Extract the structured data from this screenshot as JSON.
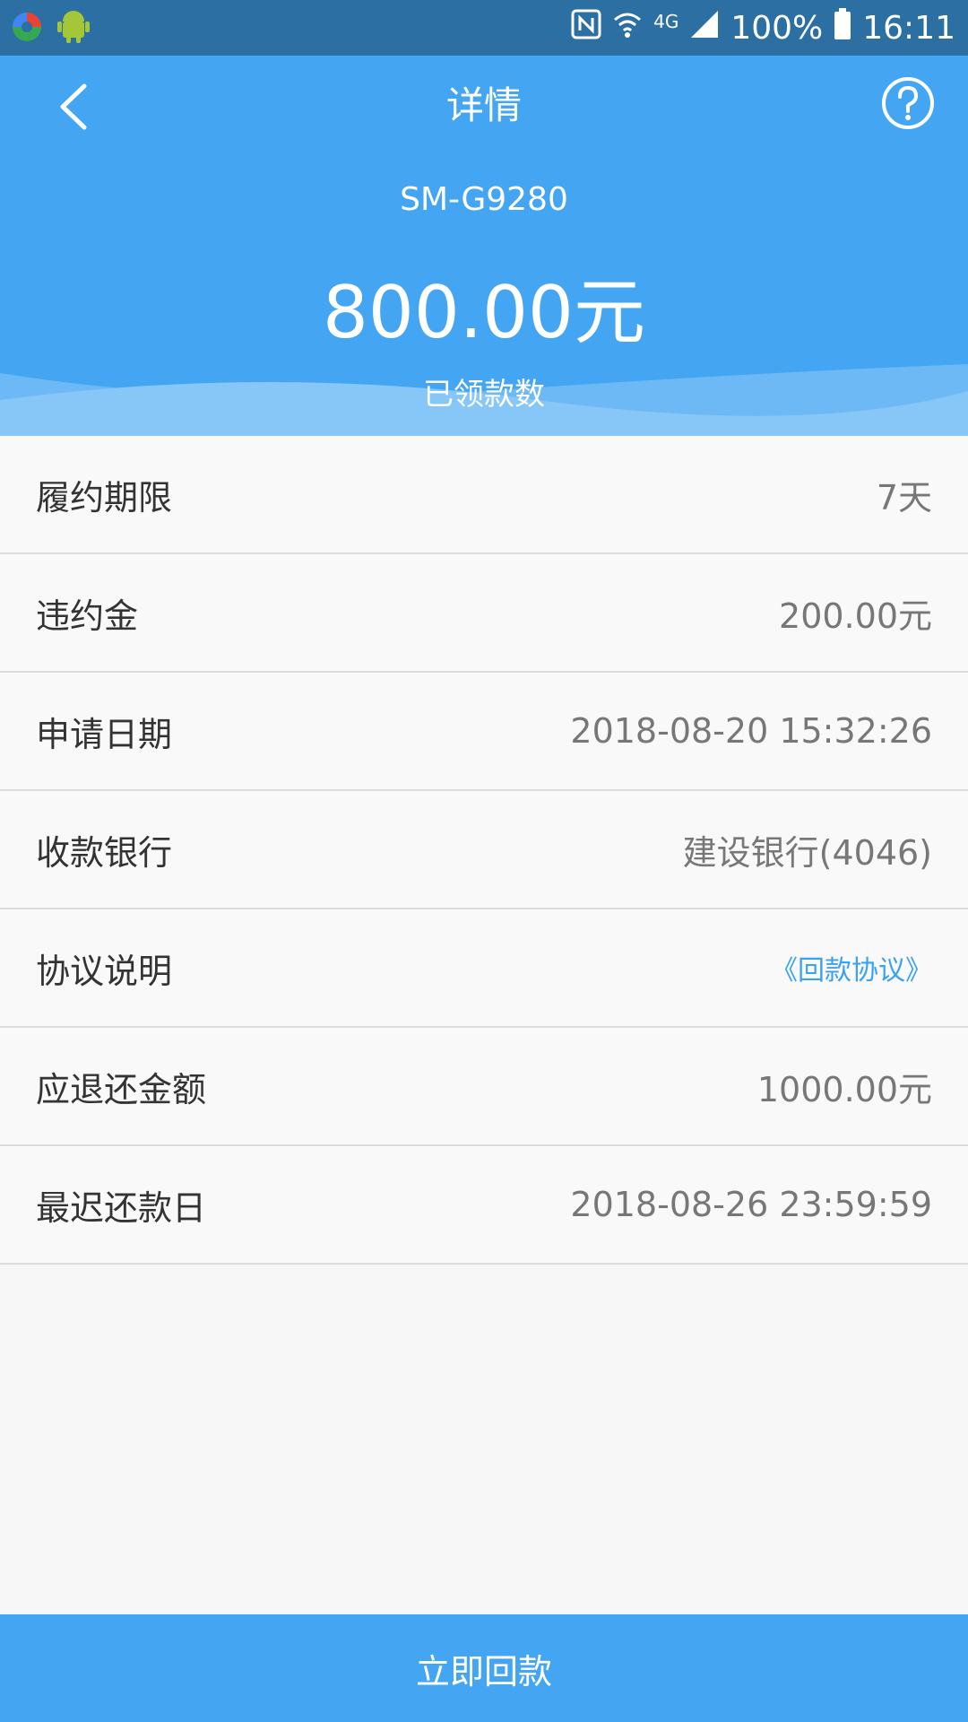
{
  "status_bar": {
    "network": "4G",
    "battery": "100%",
    "time": "16:11"
  },
  "header": {
    "title": "详情",
    "device": "SM-G9280",
    "amount": "800.00元",
    "amount_label": "已领款数"
  },
  "details": [
    {
      "label": "履约期限",
      "value": "7天"
    },
    {
      "label": "违约金",
      "value": "200.00元"
    },
    {
      "label": "申请日期",
      "value": "2018-08-20 15:32:26"
    },
    {
      "label": "收款银行",
      "value": "建设银行(4046)"
    },
    {
      "label": "协议说明",
      "value": "《回款协议》"
    },
    {
      "label": "应退还金额",
      "value": "1000.00元"
    },
    {
      "label": "最迟还款日",
      "value": "2018-08-26 23:59:59"
    }
  ],
  "bottom_button": "立即回款",
  "colors": {
    "status_bar": "#2b6fa3",
    "header": "#44a6f2",
    "link": "#3aa2f0"
  },
  "icons": [
    "app-icon",
    "android-icon",
    "nfc-icon",
    "wifi-icon",
    "signal-icon",
    "battery-icon",
    "back-arrow-icon",
    "help-icon"
  ]
}
